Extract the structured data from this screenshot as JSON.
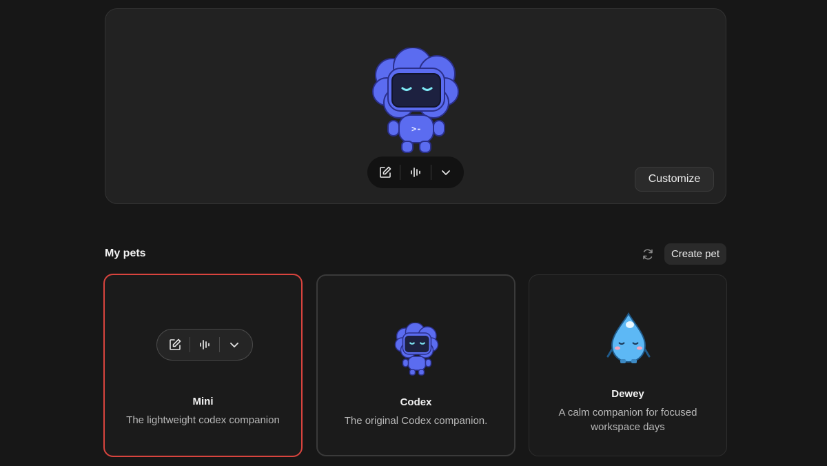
{
  "hero": {
    "customize_label": "Customize",
    "toolbar": {
      "edit_icon": "edit-icon",
      "voice_icon": "waveform-icon",
      "expand_icon": "chevron-down-icon"
    }
  },
  "section": {
    "title": "My pets",
    "refresh_icon": "refresh-icon",
    "create_label": "Create pet"
  },
  "pets": [
    {
      "name": "Mini",
      "description": "The lightweight codex companion",
      "selected": true
    },
    {
      "name": "Codex",
      "description": "The original Codex companion.",
      "selected": false
    },
    {
      "name": "Dewey",
      "description": "A calm companion for focused workspace days",
      "selected": false
    }
  ],
  "colors": {
    "background": "#171717",
    "selected_border": "#d9443e",
    "pet_blue": "#5b6cf0",
    "dewey_blue": "#5db8f5"
  }
}
